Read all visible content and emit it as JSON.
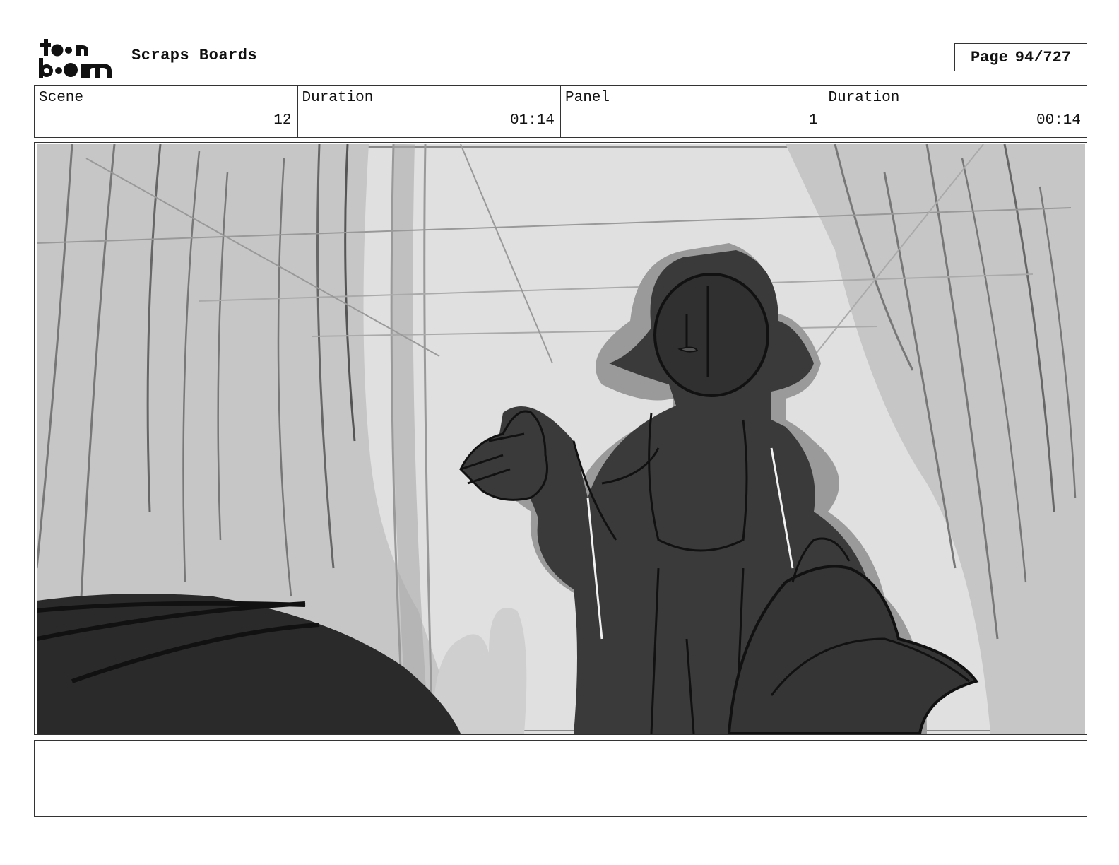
{
  "header": {
    "logo_text": "toon boom",
    "board_title": "Scraps Boards",
    "page_label": "Page",
    "page_number": "94/727"
  },
  "info": {
    "scene_label": "Scene",
    "scene_value": "12",
    "scene_duration_label": "Duration",
    "scene_duration_value": "01:14",
    "panel_label": "Panel",
    "panel_value": "1",
    "panel_duration_label": "Duration",
    "panel_duration_value": "00:14"
  },
  "panel": {
    "image_subject": "forest-character-sketch"
  },
  "notes": {
    "text": ""
  }
}
